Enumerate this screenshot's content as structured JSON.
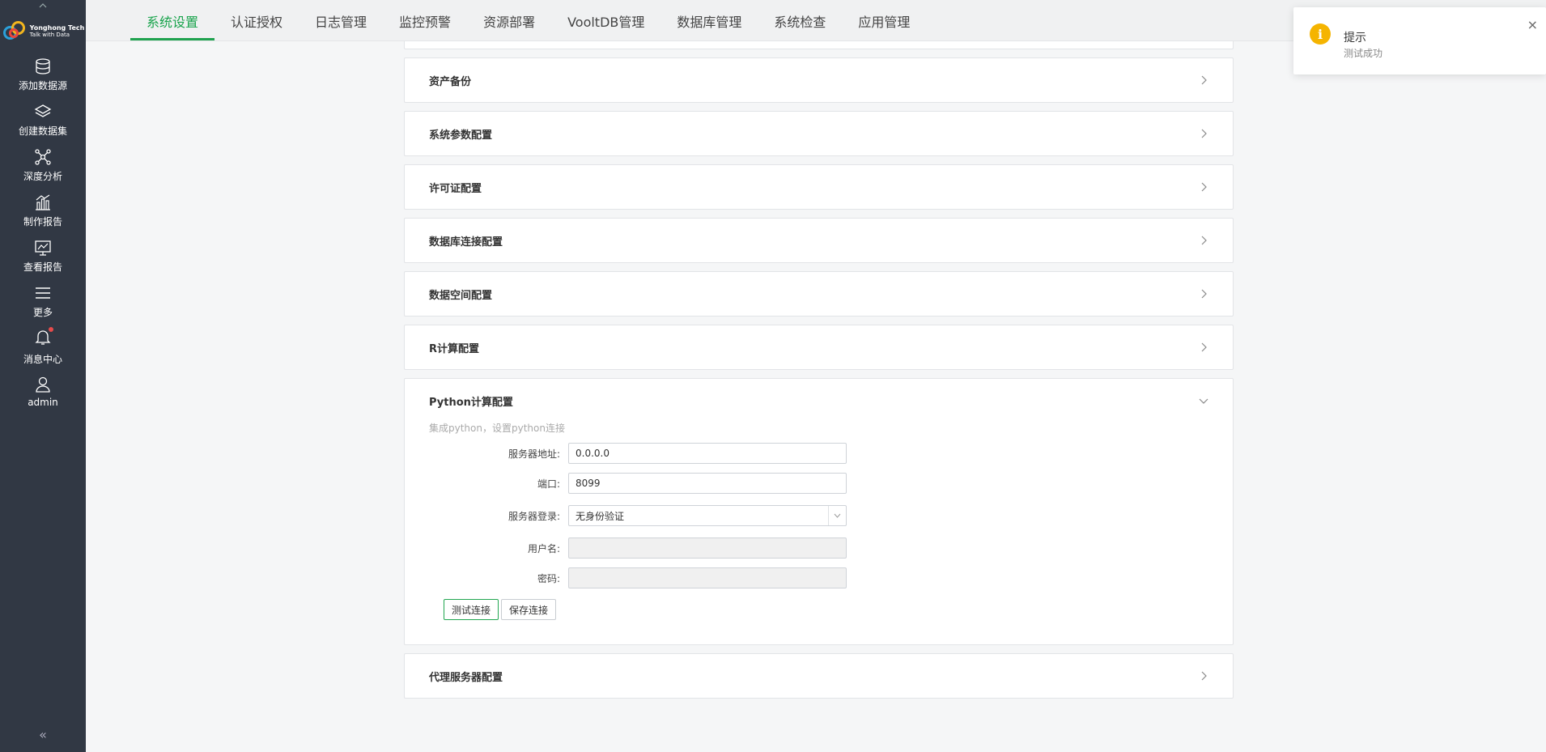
{
  "sidebar": {
    "logo": {
      "name": "Yonghong Tech",
      "tagline": "Talk with Data"
    },
    "items": [
      {
        "label": "添加数据源",
        "icon": "database-icon"
      },
      {
        "label": "创建数据集",
        "icon": "layers-icon"
      },
      {
        "label": "深度分析",
        "icon": "network-icon"
      },
      {
        "label": "制作报告",
        "icon": "bar-chart-icon"
      },
      {
        "label": "查看报告",
        "icon": "monitor-chart-icon"
      },
      {
        "label": "更多",
        "icon": "menu-icon"
      },
      {
        "label": "消息中心",
        "icon": "bell-icon",
        "badge": true
      },
      {
        "label": "admin",
        "icon": "user-icon"
      }
    ],
    "collapse": "«"
  },
  "tabs": [
    "系统设置",
    "认证授权",
    "日志管理",
    "监控预警",
    "资源部署",
    "VooltDB管理",
    "数据库管理",
    "系统检查",
    "应用管理"
  ],
  "active_tab": 0,
  "panels": [
    {
      "title": "资产备份"
    },
    {
      "title": "系统参数配置"
    },
    {
      "title": "许可证配置"
    },
    {
      "title": "数据库连接配置"
    },
    {
      "title": "数据空间配置"
    },
    {
      "title": "R计算配置"
    }
  ],
  "python_panel": {
    "title": "Python计算配置",
    "description": "集成python，设置python连接",
    "fields": {
      "server_address": {
        "label": "服务器地址:",
        "value": "0.0.0.0"
      },
      "port": {
        "label": "端口:",
        "value": "8099"
      },
      "server_login": {
        "label": "服务器登录:",
        "value": "无身份验证"
      },
      "username": {
        "label": "用户名:",
        "value": ""
      },
      "password": {
        "label": "密码:",
        "value": ""
      }
    },
    "test_button": "测试连接",
    "save_button": "保存连接"
  },
  "proxy_panel": {
    "title": "代理服务器配置"
  },
  "toast": {
    "title": "提示",
    "message": "测试成功",
    "icon": "i",
    "close": "×"
  },
  "colors": {
    "accent": "#1fa24f",
    "sidebar": "#313844",
    "warning": "#f5b400"
  }
}
